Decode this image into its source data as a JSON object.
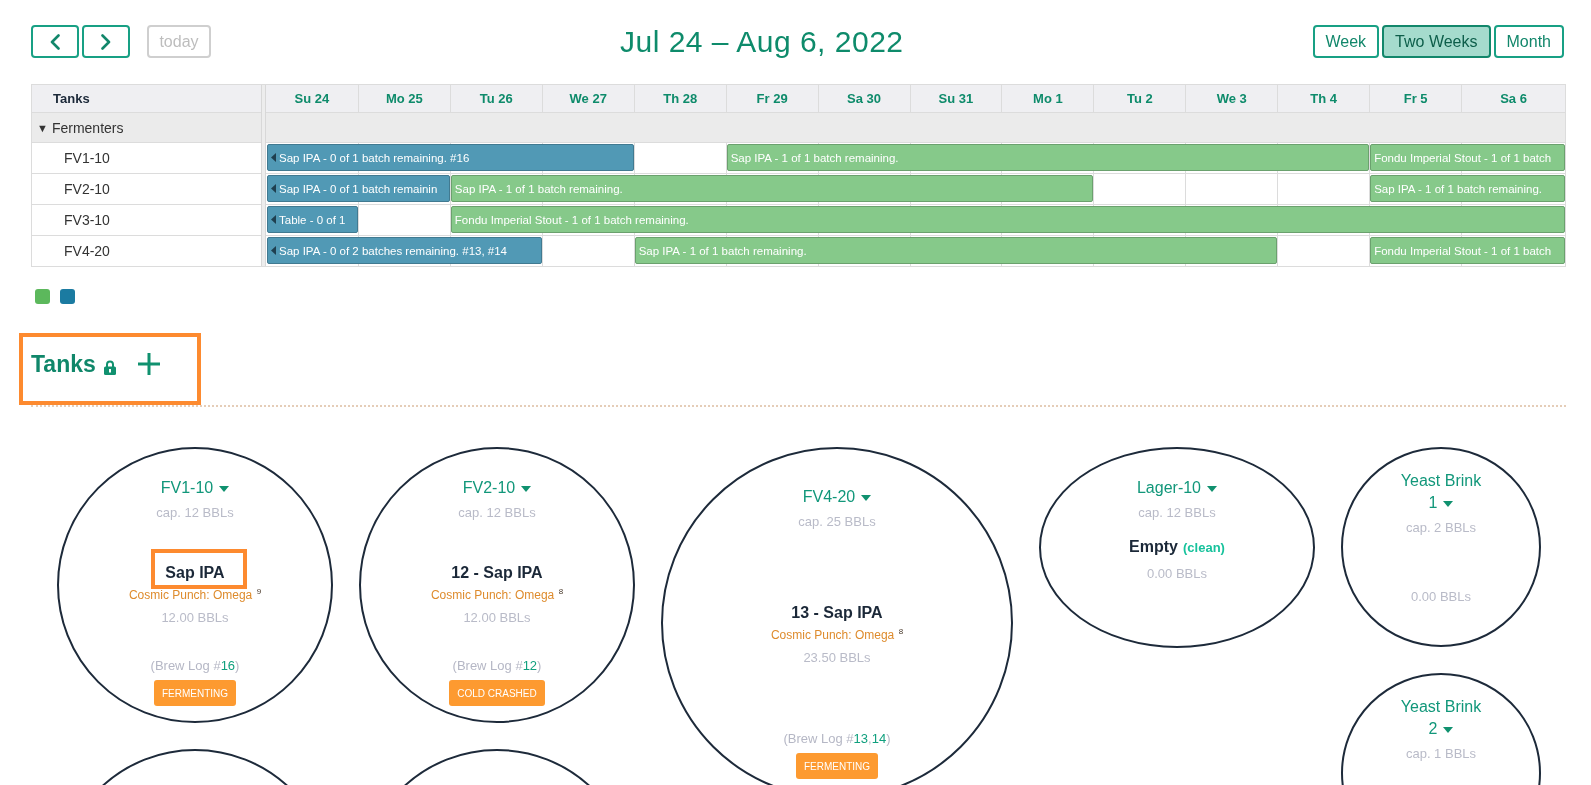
{
  "toolbar": {
    "nav": [
      {
        "kind": "prev"
      },
      {
        "kind": "next"
      }
    ],
    "today": {
      "label": "today",
      "disabled": true
    },
    "title": "Jul 24 – Aug 6, 2022",
    "views": [
      {
        "label": "Week",
        "selected": false
      },
      {
        "label": "Two Weeks",
        "selected": true
      },
      {
        "label": "Month",
        "selected": false
      }
    ]
  },
  "calendar": {
    "resource_header": "Tanks",
    "days": [
      "Su 24",
      "Mo 25",
      "Tu 26",
      "We 27",
      "Th 28",
      "Fr 29",
      "Sa 30",
      "Su 31",
      "Mo 1",
      "Tu 2",
      "We 3",
      "Th 4",
      "Fr 5",
      "Sa 6"
    ],
    "groups": [
      {
        "toggle": "▼",
        "label": "Fermenters",
        "expanded": true,
        "resources": [
          {
            "name": "FV1-10",
            "slots": [
              {
                "kind": "event",
                "title": "Sap IPA - 0 of 1 batch remaining. #16",
                "color": "#5199b5",
                "continues_before": true
              },
              {
                "kind": "continued"
              },
              {
                "kind": "continued"
              },
              {
                "kind": "continued"
              },
              {
                "kind": "free"
              },
              {
                "kind": "event",
                "title": "Sap IPA - 1 of 1 batch remaining.",
                "color": "#86c98a",
                "continues_before": false
              },
              {
                "kind": "continued"
              },
              {
                "kind": "continued"
              },
              {
                "kind": "continued"
              },
              {
                "kind": "continued"
              },
              {
                "kind": "continued"
              },
              {
                "kind": "continued"
              },
              {
                "kind": "event",
                "title": "Fondu Imperial Stout - 1 of 1 batch",
                "color": "#86c98a",
                "continues_before": false
              },
              {
                "kind": "continued"
              }
            ]
          },
          {
            "name": "FV2-10",
            "slots": [
              {
                "kind": "event",
                "title": "Sap IPA - 0 of 1 batch remainin",
                "color": "#5199b5",
                "continues_before": true
              },
              {
                "kind": "continued"
              },
              {
                "kind": "event",
                "title": "Sap IPA - 1 of 1 batch remaining.",
                "color": "#86c98a",
                "continues_before": false
              },
              {
                "kind": "continued"
              },
              {
                "kind": "continued"
              },
              {
                "kind": "continued"
              },
              {
                "kind": "continued"
              },
              {
                "kind": "continued"
              },
              {
                "kind": "continued"
              },
              {
                "kind": "free"
              },
              {
                "kind": "free"
              },
              {
                "kind": "free"
              },
              {
                "kind": "event",
                "title": "Sap IPA - 1 of 1 batch remaining.",
                "color": "#86c98a",
                "continues_before": false
              },
              {
                "kind": "continued"
              }
            ]
          },
          {
            "name": "FV3-10",
            "slots": [
              {
                "kind": "event",
                "title": "Table - 0 of 1",
                "color": "#5199b5",
                "continues_before": true
              },
              {
                "kind": "free"
              },
              {
                "kind": "event",
                "title": "Fondu Imperial Stout - 1 of 1 batch remaining.",
                "color": "#86c98a",
                "continues_before": false
              },
              {
                "kind": "continued"
              },
              {
                "kind": "continued"
              },
              {
                "kind": "continued"
              },
              {
                "kind": "continued"
              },
              {
                "kind": "continued"
              },
              {
                "kind": "continued"
              },
              {
                "kind": "continued"
              },
              {
                "kind": "continued"
              },
              {
                "kind": "continued"
              },
              {
                "kind": "continued"
              },
              {
                "kind": "continued"
              }
            ]
          },
          {
            "name": "FV4-20",
            "slots": [
              {
                "kind": "event",
                "title": "Sap IPA - 0 of 2 batches remaining. #13, #14",
                "color": "#5199b5",
                "continues_before": true
              },
              {
                "kind": "continued"
              },
              {
                "kind": "continued"
              },
              {
                "kind": "free"
              },
              {
                "kind": "event",
                "title": "Sap IPA - 1 of 1 batch remaining.",
                "color": "#86c98a",
                "continues_before": false
              },
              {
                "kind": "continued"
              },
              {
                "kind": "continued"
              },
              {
                "kind": "continued"
              },
              {
                "kind": "continued"
              },
              {
                "kind": "continued"
              },
              {
                "kind": "continued"
              },
              {
                "kind": "free"
              },
              {
                "kind": "event",
                "title": "Fondu Imperial Stout - 1 of 1 batch",
                "color": "#86c98a",
                "continues_before": false
              },
              {
                "kind": "continued"
              }
            ]
          }
        ]
      }
    ]
  },
  "legend": [
    {
      "color": "#5cb85c"
    },
    {
      "color": "#1b7ba1"
    }
  ],
  "tanks_section": {
    "title": "Tanks",
    "locked": true,
    "highlighted": true
  },
  "tanks": [
    {
      "kind": "tank",
      "name": "FV1-10",
      "capacity": "cap. 12 BBLs",
      "batch": "Sap IPA",
      "batch_highlighted": true,
      "yeast": "Cosmic Punch: Omega $^{9}$",
      "volume": "12.00 BBLs",
      "brew_log": {
        "label": "(Brew Log #",
        "numbers": [
          "16"
        ],
        "end": ")"
      },
      "status": "FERMENTING"
    },
    {
      "kind": "tank",
      "name": "FV2-10",
      "capacity": "cap. 12 BBLs",
      "batch": "12 - Sap IPA",
      "batch_highlighted": false,
      "yeast": "Cosmic Punch: Omega $^{8}$",
      "volume": "12.00 BBLs",
      "brew_log": {
        "label": "(Brew Log #",
        "numbers": [
          "12"
        ],
        "end": ")"
      },
      "status": "COLD CRASHED"
    },
    {
      "kind": "tank",
      "name": "FV4-20",
      "capacity": "cap. 25 BBLs",
      "batch": "13 - Sap IPA",
      "batch_highlighted": false,
      "yeast": "Cosmic Punch: Omega $^{8}$",
      "volume": "23.50 BBLs",
      "brew_log": {
        "label": "(Brew Log #",
        "numbers": [
          "13",
          "14"
        ],
        "separator": ",",
        "end": ")"
      },
      "status": "FERMENTING"
    },
    {
      "kind": "tank",
      "name": "Lager-10",
      "capacity": "cap. 12 BBLs",
      "batch": "Empty",
      "batch_highlighted": false,
      "batch_note": "(clean)",
      "volume": "0.00 BBLs"
    },
    {
      "kind": "tank",
      "name": "Yeast Brink 1",
      "capacity": "cap. 2 BBLs",
      "volume": "0.00 BBLs"
    },
    {
      "kind": "tank",
      "name": "Yeast Brink 2",
      "capacity": "cap. 1 BBLs"
    },
    {
      "kind": "cut_off"
    },
    {
      "kind": "cut_off"
    }
  ]
}
